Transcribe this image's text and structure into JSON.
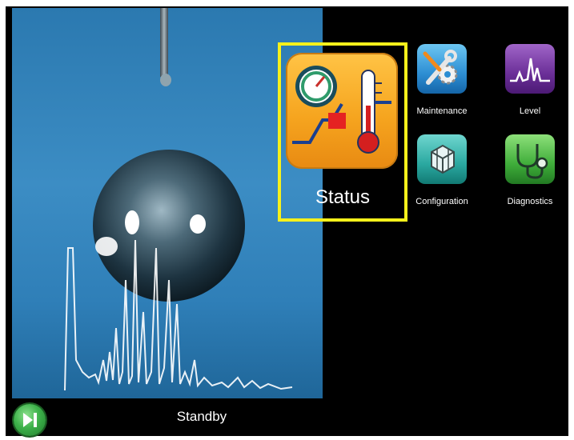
{
  "status_bar": {
    "state_text": "Standby",
    "run_button_icon": "play-pause-icon"
  },
  "menu": {
    "selected": {
      "label": "Status",
      "icon": "gauge-thermometer-icon",
      "highlight_color": "#f7f11b"
    },
    "items": [
      {
        "label": "Maintenance",
        "icon": "wrench-gear-icon"
      },
      {
        "label": "Level",
        "icon": "waveform-icon"
      },
      {
        "label": "Configuration",
        "icon": "cubes-icon"
      },
      {
        "label": "Diagnostics",
        "icon": "stethoscope-icon"
      }
    ]
  },
  "colors": {
    "background": "#000000",
    "status_orange": "#f6a51f",
    "run_green": "#3db14a"
  }
}
